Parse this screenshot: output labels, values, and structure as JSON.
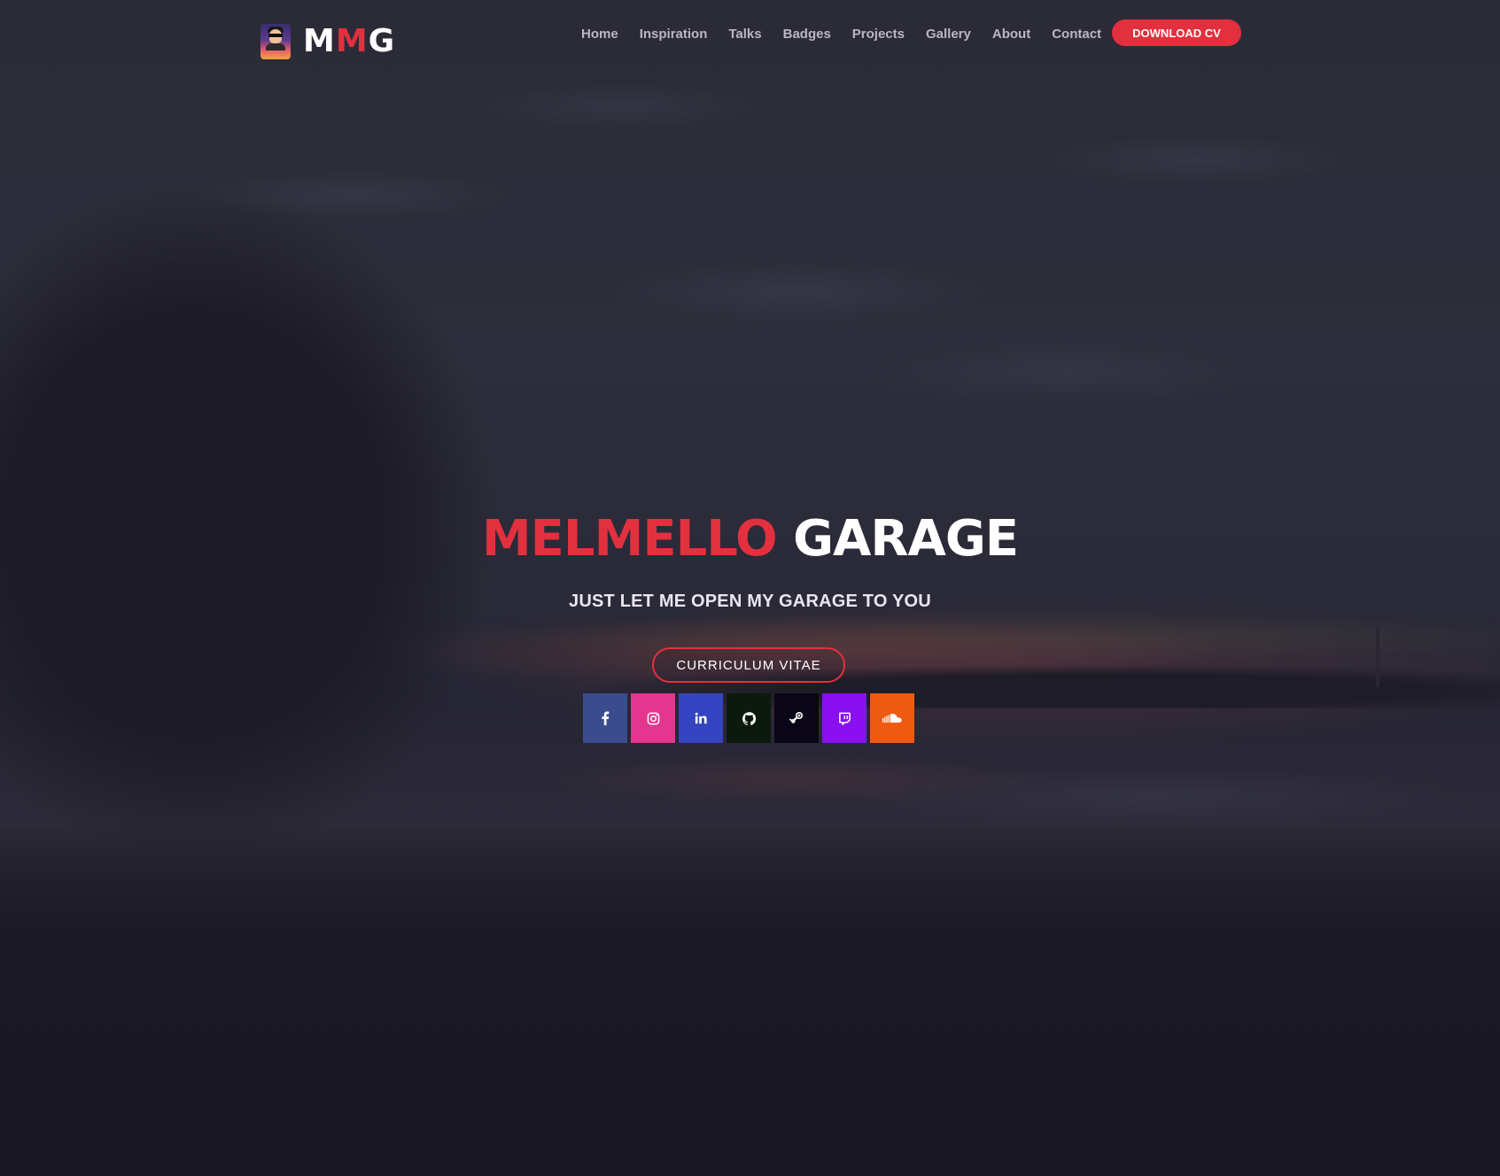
{
  "brand": {
    "logo_part1": "M",
    "logo_part2": "M",
    "logo_part3": "G"
  },
  "nav": {
    "items": [
      {
        "label": "Home"
      },
      {
        "label": "Inspiration"
      },
      {
        "label": "Talks"
      },
      {
        "label": "Badges"
      },
      {
        "label": "Projects"
      },
      {
        "label": "Gallery"
      },
      {
        "label": "About"
      },
      {
        "label": "Contact"
      }
    ],
    "cta_label": "DOWNLOAD CV"
  },
  "hero": {
    "title_red": "MELMELLO",
    "title_white": "GARAGE",
    "subtitle": "JUST LET ME OPEN MY GARAGE TO YOU",
    "cv_button_label": "CURRICULUM VITAE"
  },
  "socials": [
    {
      "name": "facebook-icon",
      "color": "#3b4c8e"
    },
    {
      "name": "instagram-icon",
      "color": "#e4358f"
    },
    {
      "name": "linkedin-icon",
      "color": "#3544c0"
    },
    {
      "name": "github-icon",
      "color": "#0b1a0c"
    },
    {
      "name": "steam-icon",
      "color": "#0a0618"
    },
    {
      "name": "twitch-icon",
      "color": "#8a10f0"
    },
    {
      "name": "soundcloud-icon",
      "color": "#ee5a12"
    }
  ],
  "colors": {
    "accent": "#e2303f",
    "background": "#1c1b29"
  }
}
